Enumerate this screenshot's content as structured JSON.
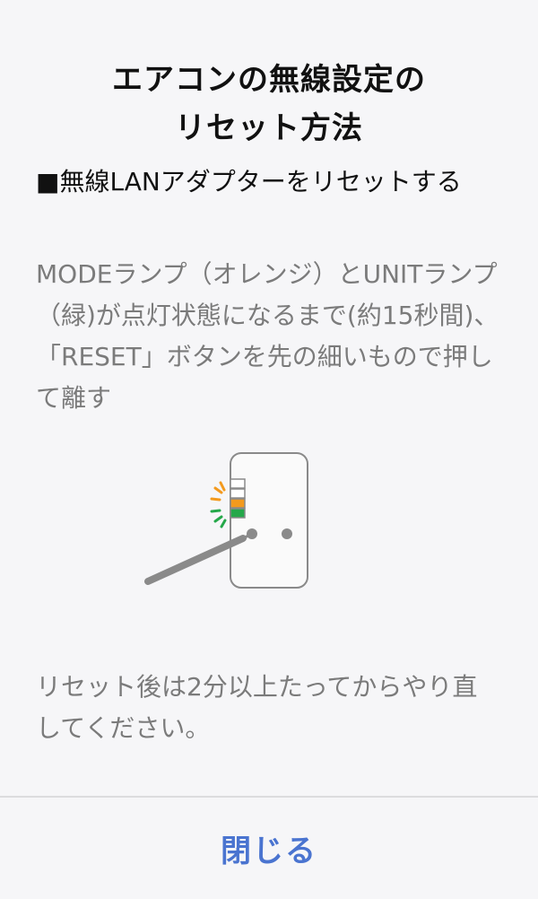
{
  "title": {
    "line1": "エアコンの無線設定の",
    "line2": "リセット方法"
  },
  "section_heading": "■無線LANアダプターをリセットする",
  "instruction": "MODEランプ（オレンジ）とUNITランプ（緑)が点灯状態になるまで(約15秒間)、「RESET」ボタンを先の細いもので押して離す",
  "illustration": {
    "colors": {
      "orange": "#f39a1e",
      "green": "#25a84a",
      "outline": "#8a8a8a"
    }
  },
  "note": "リセット後は2分以上たってからやり直してください。",
  "close_button": {
    "label": "閉じる",
    "color": "#4a74d0"
  }
}
